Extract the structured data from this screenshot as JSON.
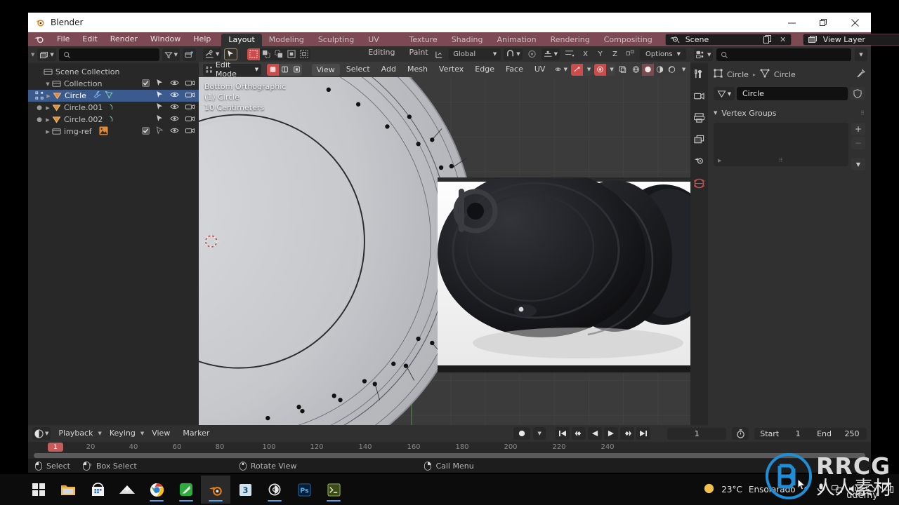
{
  "window": {
    "title": "Blender",
    "controls": {
      "minimize": "–",
      "maximize": "❐",
      "close": "✕"
    }
  },
  "menubar": {
    "items": [
      "File",
      "Edit",
      "Render",
      "Window",
      "Help"
    ]
  },
  "workspace_tabs": [
    {
      "label": "Layout",
      "active": true
    },
    {
      "label": "Modeling",
      "active": false
    },
    {
      "label": "Sculpting",
      "active": false
    },
    {
      "label": "UV Editing",
      "active": false
    },
    {
      "label": "Texture Paint",
      "active": false
    },
    {
      "label": "Shading",
      "active": false
    },
    {
      "label": "Animation",
      "active": false
    },
    {
      "label": "Rendering",
      "active": false
    },
    {
      "label": "Compositing",
      "active": false
    }
  ],
  "scene_selector": {
    "value": "Scene",
    "icon": "scene-icon"
  },
  "viewlayer_selector": {
    "value": "View Layer",
    "icon": "viewlayer-icon"
  },
  "outliner": {
    "search_placeholder": "",
    "display_mode": "View Layer",
    "rows": [
      {
        "label": "Scene Collection",
        "indent": 0,
        "icon": "collection-icon",
        "selected": false,
        "checkbox": false,
        "disclosure": ""
      },
      {
        "label": "Collection",
        "indent": 1,
        "icon": "collection-icon",
        "selected": false,
        "checkbox": true,
        "disclosure": "▼"
      },
      {
        "label": "Circle",
        "indent": 2,
        "icon": "mesh-triangle-icon",
        "selected": true,
        "checkbox": false,
        "disclosure": "▶"
      },
      {
        "label": "Circle.001",
        "indent": 2,
        "icon": "mesh-triangle-icon",
        "selected": false,
        "checkbox": false,
        "disclosure": "▶"
      },
      {
        "label": "Circle.002",
        "indent": 2,
        "icon": "mesh-triangle-icon",
        "selected": false,
        "checkbox": false,
        "disclosure": "▶"
      },
      {
        "label": "img-ref",
        "indent": 1,
        "icon": "collection-icon",
        "selected": false,
        "checkbox": true,
        "disclosure": "▶"
      }
    ]
  },
  "viewport_header": {
    "editor_type": "editor-type-icon",
    "transform_orientation": "Global",
    "options_label": "Options",
    "axis_labels": [
      "X",
      "Y",
      "Z"
    ],
    "mode": "Edit Mode",
    "menus": [
      "View",
      "Select",
      "Add",
      "Mesh",
      "Vertex",
      "Edge",
      "Face",
      "UV"
    ],
    "select_modes": [
      "vertex-select-icon",
      "edge-select-icon",
      "face-select-icon"
    ]
  },
  "viewport_overlay": {
    "view_name": "Bottom Orthographic",
    "object_line": "(1) Circle",
    "grid_scale": "10 Centimeters"
  },
  "properties": {
    "search_placeholder": "",
    "breadcrumb": [
      {
        "label": "Circle",
        "icon": "object-data-icon"
      },
      {
        "label": "Circle",
        "icon": "mesh-data-icon"
      }
    ],
    "mesh_name": "Circle",
    "panels": [
      {
        "label": "Vertex Groups",
        "expanded": true,
        "items": []
      }
    ],
    "tabs": [
      "tool-icon",
      "render-icon",
      "output-icon",
      "viewlayer-icon",
      "scene-icon",
      "world-icon"
    ]
  },
  "timeline": {
    "playback_menu": "Playback",
    "keying_menu": "Keying",
    "view_menu": "View",
    "marker_menu": "Marker",
    "current_frame": "1",
    "start_label": "Start",
    "start_value": "1",
    "end_label": "End",
    "end_value": "250",
    "ruler_ticks": [
      "20",
      "40",
      "60",
      "80",
      "100",
      "120",
      "140",
      "160",
      "180",
      "200",
      "220",
      "240"
    ],
    "playhead_frame": "1",
    "transport_buttons": [
      "jump-to-start-icon",
      "prev-keyframe-icon",
      "play-reverse-icon",
      "play-icon",
      "next-keyframe-icon",
      "jump-to-end-icon"
    ]
  },
  "status_bar": {
    "items": [
      {
        "mouse": "left-mouse-icon",
        "label": "Select"
      },
      {
        "mouse": "left-mouse-drag-icon",
        "label": "Box Select"
      },
      {
        "mouse": "middle-mouse-icon",
        "label": "Rotate View"
      },
      {
        "mouse": "right-mouse-icon",
        "label": "Call Menu"
      }
    ]
  },
  "taskbar": {
    "start_icon": "windows-start-icon",
    "apps": [
      {
        "name": "file-explorer-icon",
        "running": false,
        "active": false
      },
      {
        "name": "microsoft-store-icon",
        "running": false,
        "active": false
      },
      {
        "name": "mail-icon",
        "running": false,
        "active": false
      },
      {
        "name": "google-chrome-icon",
        "running": true,
        "active": false
      },
      {
        "name": "nvidia-icon",
        "running": true,
        "active": false
      },
      {
        "name": "blender-icon",
        "running": true,
        "active": true
      },
      {
        "name": "3ds-max-icon",
        "running": false,
        "active": false
      },
      {
        "name": "substance-painter-icon",
        "running": true,
        "active": false
      },
      {
        "name": "photoshop-icon",
        "running": false,
        "active": false
      },
      {
        "name": "terminal-icon",
        "running": true,
        "active": false
      }
    ],
    "tray": {
      "weather_temp": "23°C",
      "weather_text": "Ensolarado",
      "chevron": "^",
      "icons": [
        "microphone-icon",
        "network-icon",
        "volume-icon",
        "onedrive-icon",
        "pc-icon"
      ]
    }
  },
  "watermark": {
    "brand": "RRCG",
    "subtitle": "人人素材",
    "source": "udemy"
  }
}
